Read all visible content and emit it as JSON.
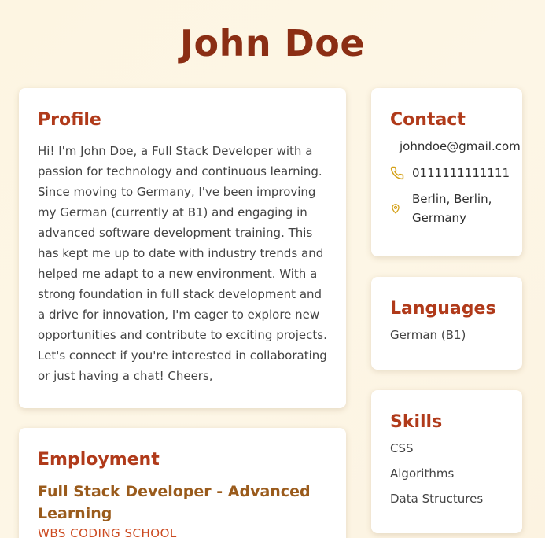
{
  "header": {
    "name": "John Doe"
  },
  "profile": {
    "title": "Profile",
    "text": "Hi! I'm John Doe, a Full Stack Developer with a passion for technology and continuous learning. Since moving to Germany, I've been improving my German (currently at B1) and engaging in advanced software development training. This has kept me up to date with industry trends and helped me adapt to a new environment. With a strong foundation in full stack development and a drive for innovation, I'm eager to explore new opportunities and contribute to exciting projects. Let's connect if you're interested in collaborating or just having a chat! Cheers,"
  },
  "employment": {
    "title": "Employment",
    "job_title": "Full Stack Developer - Advanced Learning",
    "company": "WBS CODING SCHOOL"
  },
  "contact": {
    "title": "Contact",
    "email": "johndoe@gmail.com",
    "phone": "0111111111111",
    "address": "Berlin, Berlin, Germany",
    "icons": {
      "phone": "phone-icon",
      "location": "location-pin-icon"
    },
    "icon_color": "#d4a017"
  },
  "languages": {
    "title": "Languages",
    "items": [
      "German (B1)"
    ]
  },
  "skills": {
    "title": "Skills",
    "items": [
      "CSS",
      "Algorithms",
      "Data Structures"
    ]
  },
  "colors": {
    "name": "#8b2e14",
    "section_title": "#b03a1a",
    "job_title": "#9a5b1c",
    "company": "#cc4a20"
  }
}
